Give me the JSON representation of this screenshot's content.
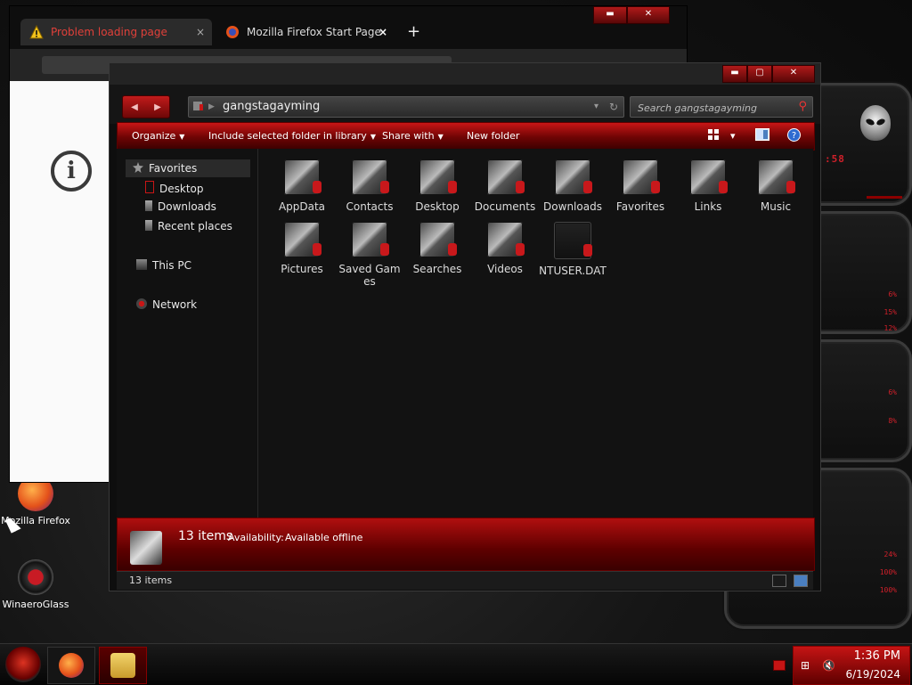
{
  "browser": {
    "tabs": [
      {
        "label": "Problem loading page",
        "state": "active",
        "icon": "warning-icon"
      },
      {
        "label": "Mozilla Firefox Start Page",
        "state": "inactive",
        "icon": "firefox-icon"
      }
    ],
    "new_tab": "+",
    "tab_close": "×",
    "content_icon": "info-icon"
  },
  "explorer": {
    "address": {
      "path": "gangstagayming"
    },
    "search": {
      "placeholder": "Search gangstagayming"
    },
    "toolbar": {
      "organize": "Organize",
      "include": "Include selected folder in library",
      "share": "Share with",
      "new_folder": "New folder"
    },
    "nav": {
      "favorites": "Favorites",
      "items": [
        "Desktop",
        "Downloads",
        "Recent places"
      ],
      "this_pc": "This PC",
      "network": "Network"
    },
    "files": [
      {
        "label": "AppData"
      },
      {
        "label": "Contacts"
      },
      {
        "label": "Desktop"
      },
      {
        "label": "Documents"
      },
      {
        "label": "Downloads"
      },
      {
        "label": "Favorites"
      },
      {
        "label": "Links"
      },
      {
        "label": "Music"
      },
      {
        "label": "Pictures"
      },
      {
        "label": "Saved Games"
      },
      {
        "label": "Searches"
      },
      {
        "label": "Videos"
      },
      {
        "label": "NTUSER.DAT"
      }
    ],
    "details": {
      "count": "13 items",
      "availability_label": "Availability:",
      "availability_value": "Available offline"
    },
    "status": {
      "count": "13 items"
    }
  },
  "desktop": {
    "icons": [
      {
        "label": "Mozilla Firefox"
      },
      {
        "label": "WinaeroGlass"
      }
    ]
  },
  "taskbar": {
    "time": "1:36 PM",
    "date": "6/19/2024"
  },
  "gadgets": {
    "clock_text": ":58",
    "values": [
      "6%",
      "15%",
      "12%",
      "6%",
      "8%",
      "24%",
      "100%",
      "100%"
    ]
  },
  "colors": {
    "accent": "#c81616",
    "accent_dark": "#5e0000",
    "background": "#0e0e0e"
  }
}
